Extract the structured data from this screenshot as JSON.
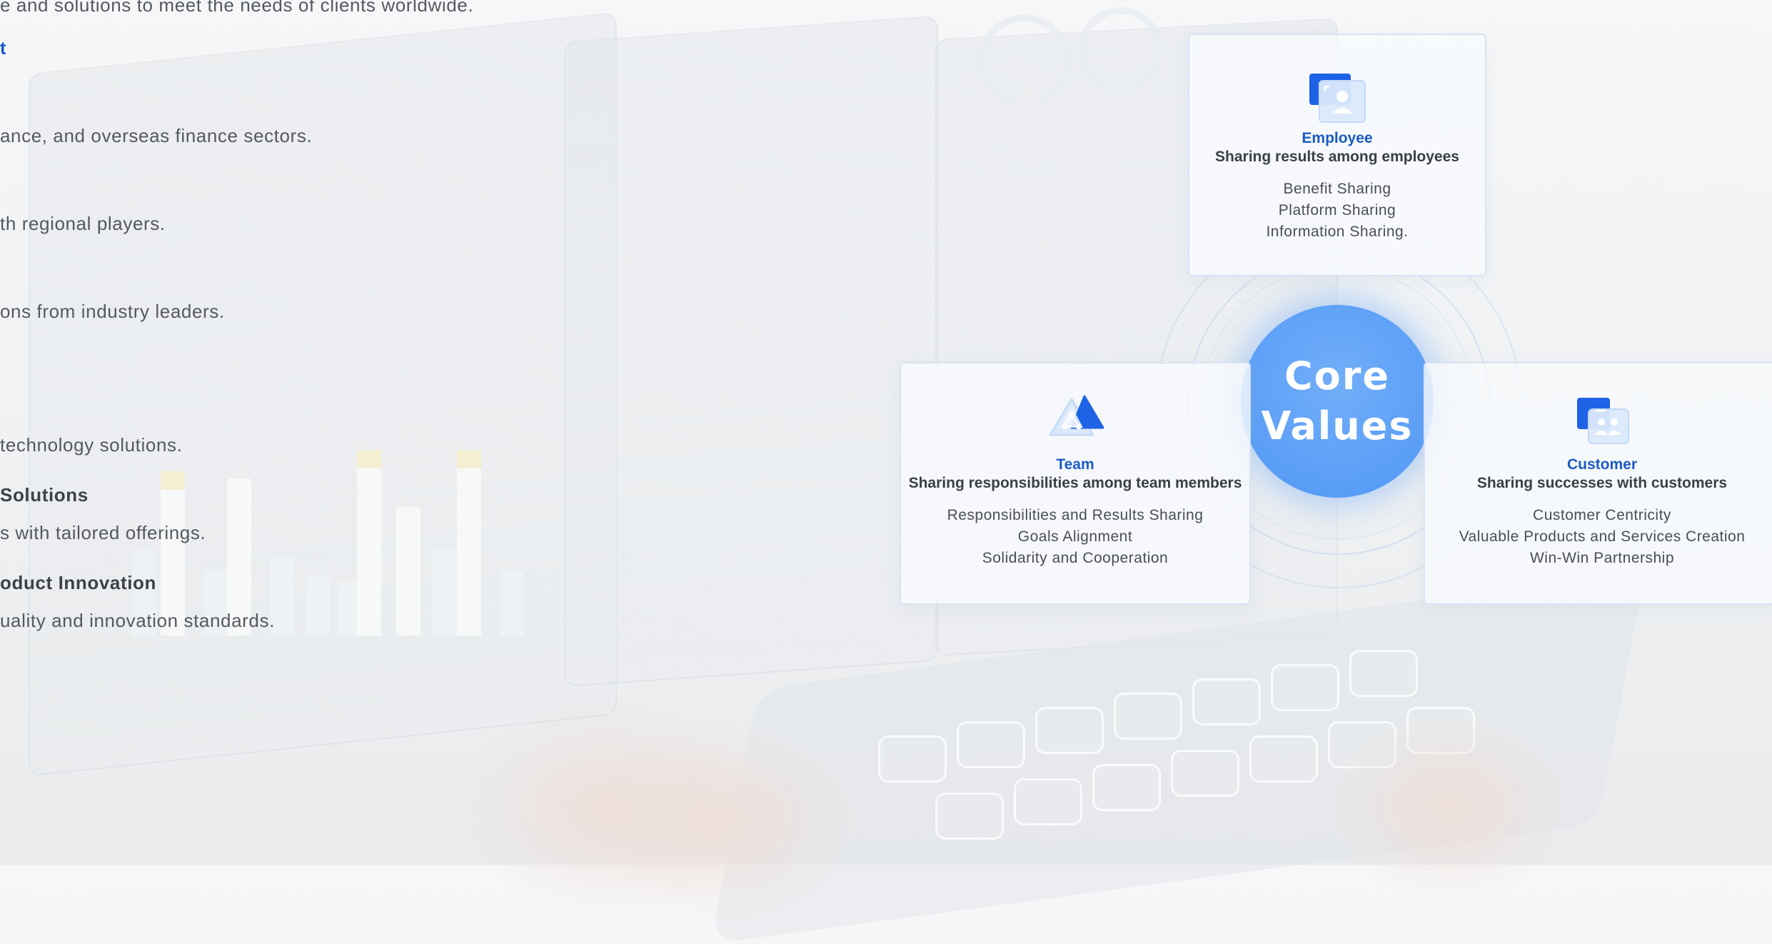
{
  "left_column": {
    "line_intro": "e and solutions to meet the needs of clients worldwide.",
    "line_link": "t",
    "line_finance": "ance, and overseas finance sectors.",
    "line_regional": "th regional players.",
    "line_leaders": "ons from industry leaders.",
    "line_technology": "technology solutions.",
    "heading_solutions": "Solutions",
    "line_tailored": "s with tailored offerings.",
    "heading_innovation": "oduct Innovation",
    "line_quality": "uality and innovation standards."
  },
  "core_values": {
    "center_line1": "Core",
    "center_line2": "Values",
    "employee": {
      "title": "Employee",
      "subtitle": "Sharing results among employees",
      "items": [
        "Benefit Sharing",
        "Platform Sharing",
        "Information Sharing."
      ]
    },
    "team": {
      "title": "Team",
      "subtitle": "Sharing responsibilities among team members",
      "items": [
        "Responsibilities and Results Sharing",
        "Goals Alignment",
        "Solidarity and Cooperation"
      ]
    },
    "customer": {
      "title": "Customer",
      "subtitle": "Sharing successes with customers",
      "items": [
        "Customer Centricity",
        "Valuable Products and Services Creation",
        "Win-Win Partnership"
      ]
    }
  },
  "icons": {
    "employee": "employee-profile-icon",
    "team": "team-network-icon",
    "customer": "customer-group-icon"
  },
  "colors": {
    "accent_blue": "#1c5bc7",
    "core_circle": "#5a9ef6",
    "body_text": "#55595f"
  }
}
